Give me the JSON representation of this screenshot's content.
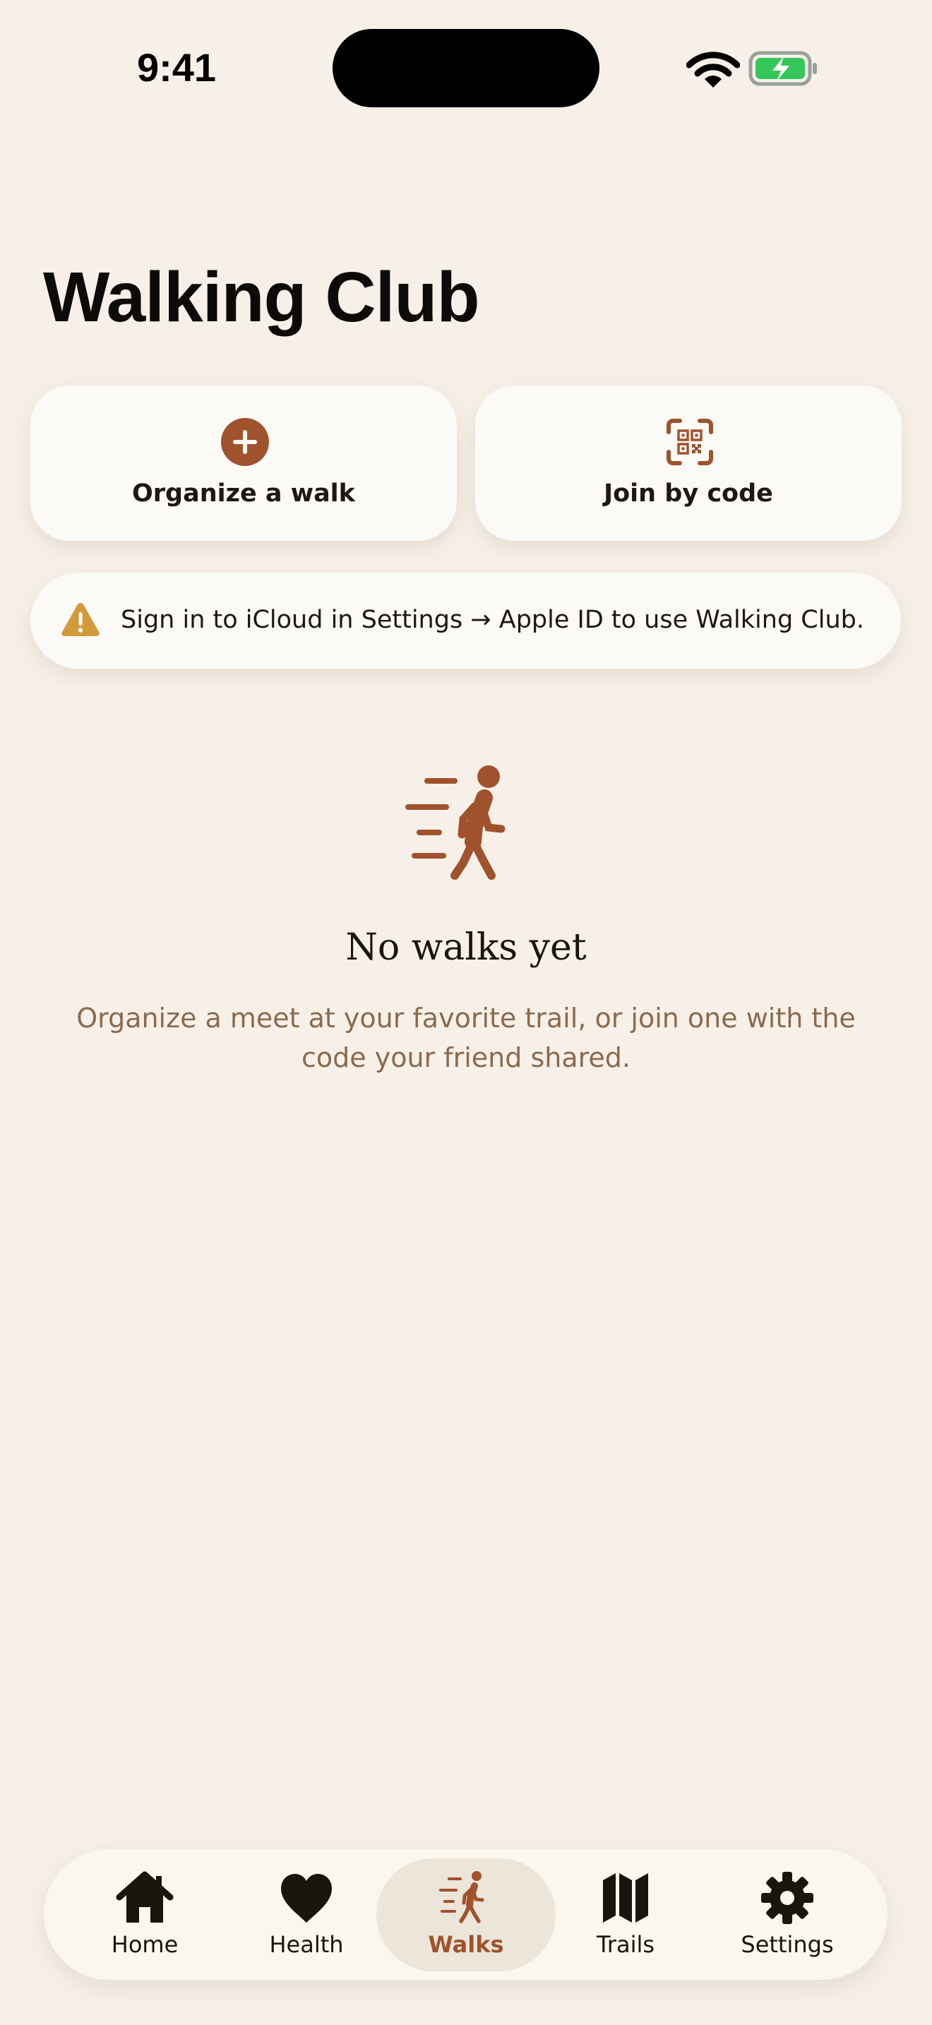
{
  "status_bar": {
    "time": "9:41"
  },
  "header": {
    "title": "Walking Club"
  },
  "actions": {
    "organize_label": "Organize a walk",
    "join_label": "Join by code"
  },
  "warning": {
    "text": "Sign in to iCloud in Settings → Apple ID to use Walking Club."
  },
  "empty_state": {
    "title": "No walks yet",
    "description": "Organize a meet at your favorite trail, or join one with the code your friend shared."
  },
  "tab_bar": {
    "active": "Walks",
    "items": [
      {
        "label": "Home",
        "icon": "house-icon"
      },
      {
        "label": "Health",
        "icon": "heart-icon"
      },
      {
        "label": "Walks",
        "icon": "walking-figure-icon"
      },
      {
        "label": "Trails",
        "icon": "map-icon"
      },
      {
        "label": "Settings",
        "icon": "gear-icon"
      }
    ]
  },
  "colors": {
    "background": "#F6F0E8",
    "card": "#FCFAF6",
    "accent": "#A0522D",
    "warning": "#D29A3A",
    "muted_text": "#8C6A4E",
    "battery_green": "#34C759"
  }
}
